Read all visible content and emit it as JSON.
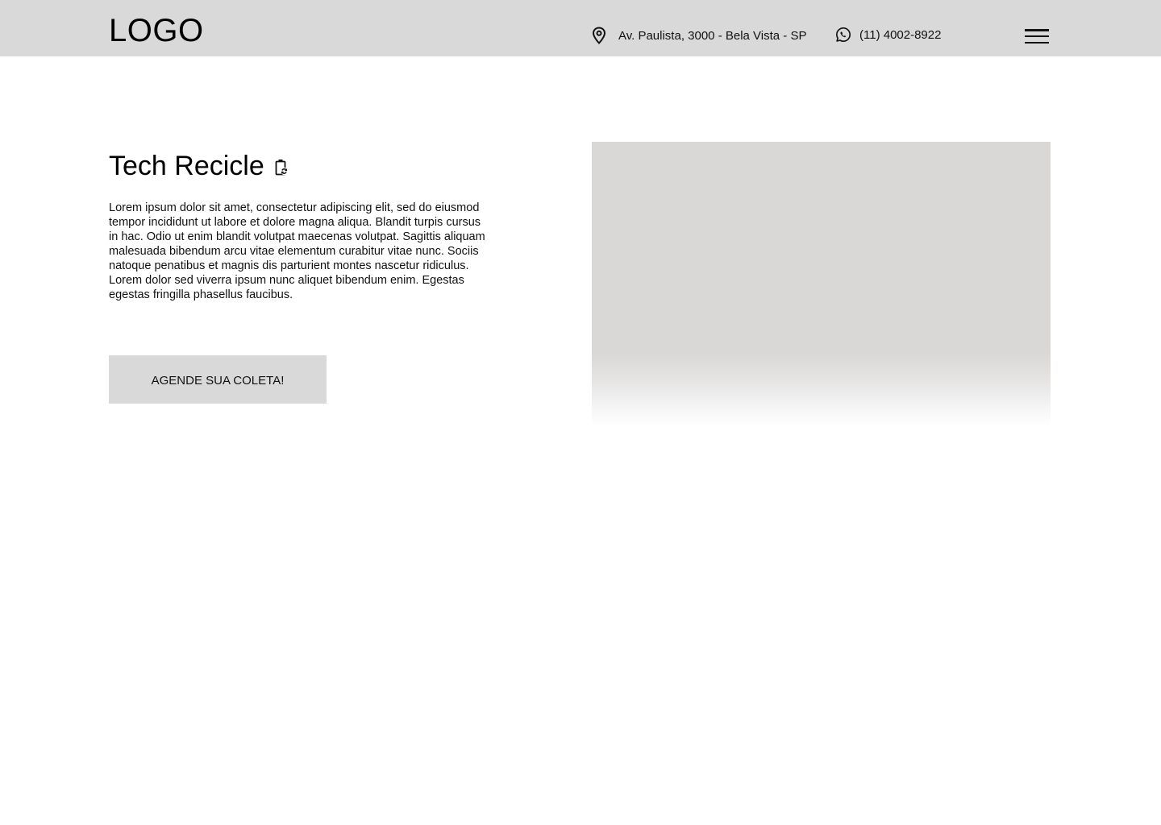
{
  "header": {
    "logo": "LOGO",
    "address": {
      "text": "Av. Paulista, 3000 - Bela Vista - SP",
      "icon": "location-pin-icon"
    },
    "phone": {
      "text": "(11) 4002-8922",
      "icon": "whatsapp-icon"
    },
    "menu_icon": "hamburger-menu-icon"
  },
  "hero": {
    "title": "Tech Recicle",
    "title_icon": "battery-recycle-icon",
    "description": "Lorem ipsum dolor sit amet, consectetur adipiscing elit, sed do eiusmod tempor incididunt ut labore et dolore magna aliqua. Blandit turpis cursus in hac. Odio ut enim blandit volutpat maecenas volutpat. Sagittis aliquam malesuada bibendum arcu vitae elementum curabitur vitae nunc. Sociis natoque penatibus et magnis dis parturient montes nascetur ridiculus. Lorem dolor sed viverra ipsum nunc aliquet bibendum enim. Egestas egestas fringilla phasellus faucibus.",
    "cta_label": "AGENDE SUA COLETA!"
  },
  "colors": {
    "header_bg": "#d9d9d9",
    "button_bg": "#d9d9d9",
    "image_placeholder": "#d9d8d6",
    "text": "#111111"
  }
}
